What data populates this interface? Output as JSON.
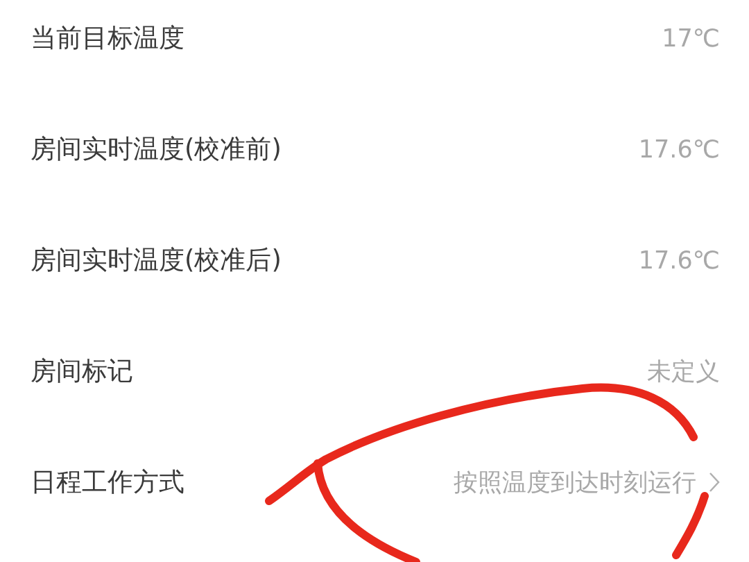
{
  "settings": [
    {
      "label": "当前目标温度",
      "value": "17℃",
      "kind": "text"
    },
    {
      "label": "房间实时温度(校准前)",
      "value": "17.6℃",
      "kind": "text"
    },
    {
      "label": "房间实时温度(校准后)",
      "value": "17.6℃",
      "kind": "text"
    },
    {
      "label": "房间标记",
      "value": "未定义",
      "kind": "text"
    },
    {
      "label": "日程工作方式",
      "value": "按照温度到达时刻运行",
      "kind": "link"
    }
  ]
}
